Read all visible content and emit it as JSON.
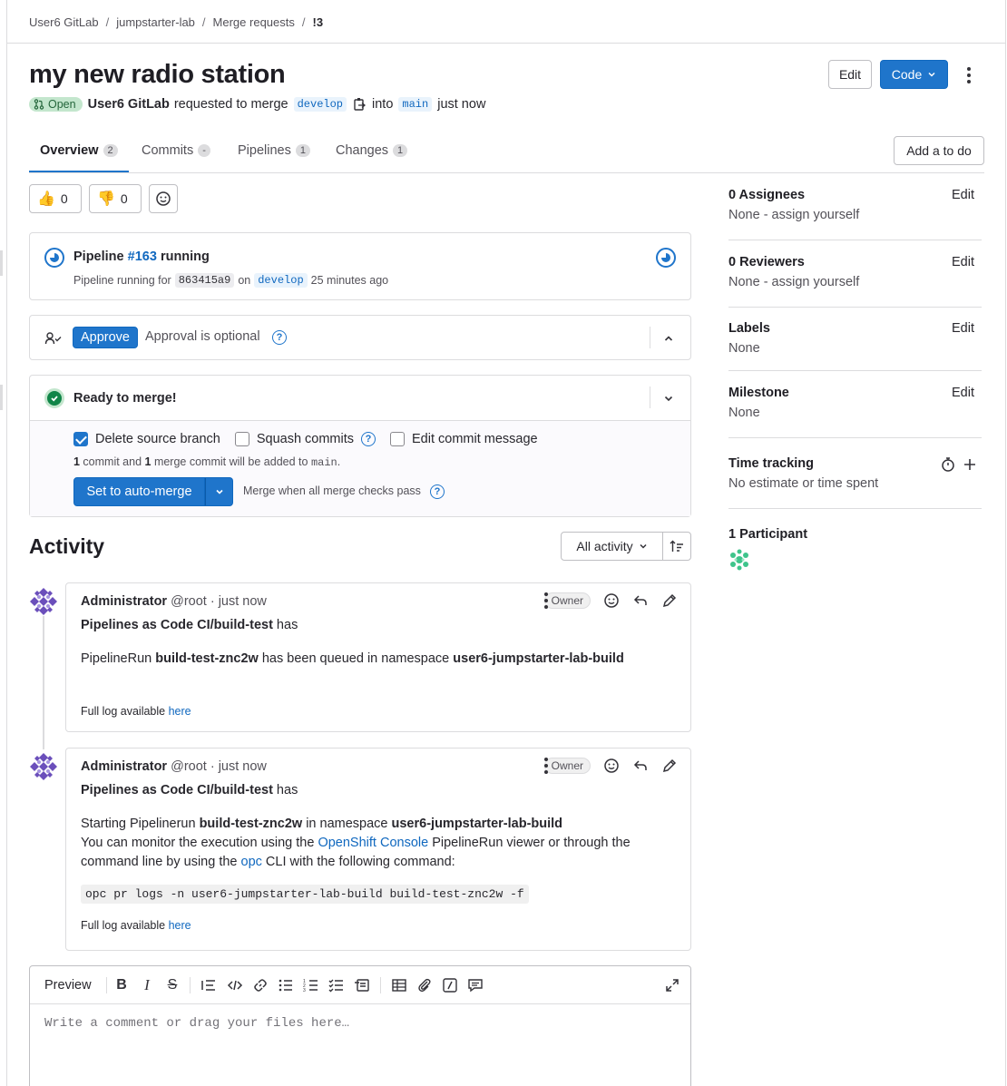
{
  "breadcrumbs": [
    "User6 GitLab",
    "jumpstarter-lab",
    "Merge requests",
    "!3"
  ],
  "title": "my new radio station",
  "header_buttons": {
    "edit": "Edit",
    "code": "Code"
  },
  "status": {
    "badge": "Open",
    "author": "User6 GitLab",
    "requested": "requested to merge",
    "source_branch": "develop",
    "into": "into",
    "target_branch": "main",
    "time": "just now"
  },
  "tabs": [
    {
      "label": "Overview",
      "count": "2"
    },
    {
      "label": "Commits",
      "count": "-"
    },
    {
      "label": "Pipelines",
      "count": "1"
    },
    {
      "label": "Changes",
      "count": "1"
    }
  ],
  "todo_button": "Add a to do",
  "reactions": {
    "thumbs_up": "0",
    "thumbs_down": "0"
  },
  "pipeline": {
    "label": "Pipeline",
    "id": "#163",
    "state": "running",
    "sub_prefix": "Pipeline running for",
    "commit": "863415a9",
    "on": "on",
    "branch": "develop",
    "ago": "25 minutes ago"
  },
  "approval": {
    "button": "Approve",
    "text": "Approval is optional"
  },
  "merge": {
    "title": "Ready to merge!",
    "delete_source": "Delete source branch",
    "squash": "Squash commits",
    "edit_message": "Edit commit message",
    "info_1": "1",
    "info_2": " commit and ",
    "info_3": "1",
    "info_4": " merge commit will be added to ",
    "info_branch": "main",
    "info_end": ".",
    "auto_merge": "Set to auto-merge",
    "when": "Merge when all merge checks pass"
  },
  "activity": {
    "title": "Activity",
    "filter": "All activity"
  },
  "notes": [
    {
      "author": "Administrator",
      "handle": "@root · just now",
      "badge": "Owner",
      "line1_bold": "Pipelines as Code CI/build-test",
      "line1_rest": " has",
      "p1_a": "PipelineRun ",
      "p1_b": "build-test-znc2w",
      "p1_c": " has been queued in namespace ",
      "p1_d": "user6-jumpstarter-lab-build",
      "log_text": "Full log available ",
      "log_link": "here"
    },
    {
      "author": "Administrator",
      "handle": "@root · just now",
      "badge": "Owner",
      "line1_bold": "Pipelines as Code CI/build-test",
      "line1_rest": " has",
      "p1_a": "Starting Pipelinerun ",
      "p1_b": "build-test-znc2w",
      "p1_c": " in namespace ",
      "p1_d": "user6-jumpstarter-lab-build",
      "p2_a": "You can monitor the execution using the ",
      "p2_link": "OpenShift Console",
      "p2_b": " PipelineRun viewer or through the",
      "p3_a": "command line by using the ",
      "p3_link": "opc",
      "p3_b": " CLI with the following command:",
      "code": "opc pr logs -n user6-jumpstarter-lab-build build-test-znc2w -f",
      "log_text": "Full log available ",
      "log_link": "here"
    }
  ],
  "editor": {
    "preview": "Preview",
    "placeholder": "Write a comment or drag your files here…"
  },
  "sidebar": {
    "assignees": {
      "title": "0 Assignees",
      "edit": "Edit",
      "value": "None - assign yourself"
    },
    "reviewers": {
      "title": "0 Reviewers",
      "edit": "Edit",
      "value": "None - assign yourself"
    },
    "labels": {
      "title": "Labels",
      "edit": "Edit",
      "value": "None"
    },
    "milestone": {
      "title": "Milestone",
      "edit": "Edit",
      "value": "None"
    },
    "time": {
      "title": "Time tracking",
      "value": "No estimate or time spent"
    },
    "participants": {
      "title": "1 Participant"
    }
  },
  "colors": {
    "primary": "#1f75cb",
    "success": "#108548",
    "open_badge": "#c3e6cd"
  }
}
